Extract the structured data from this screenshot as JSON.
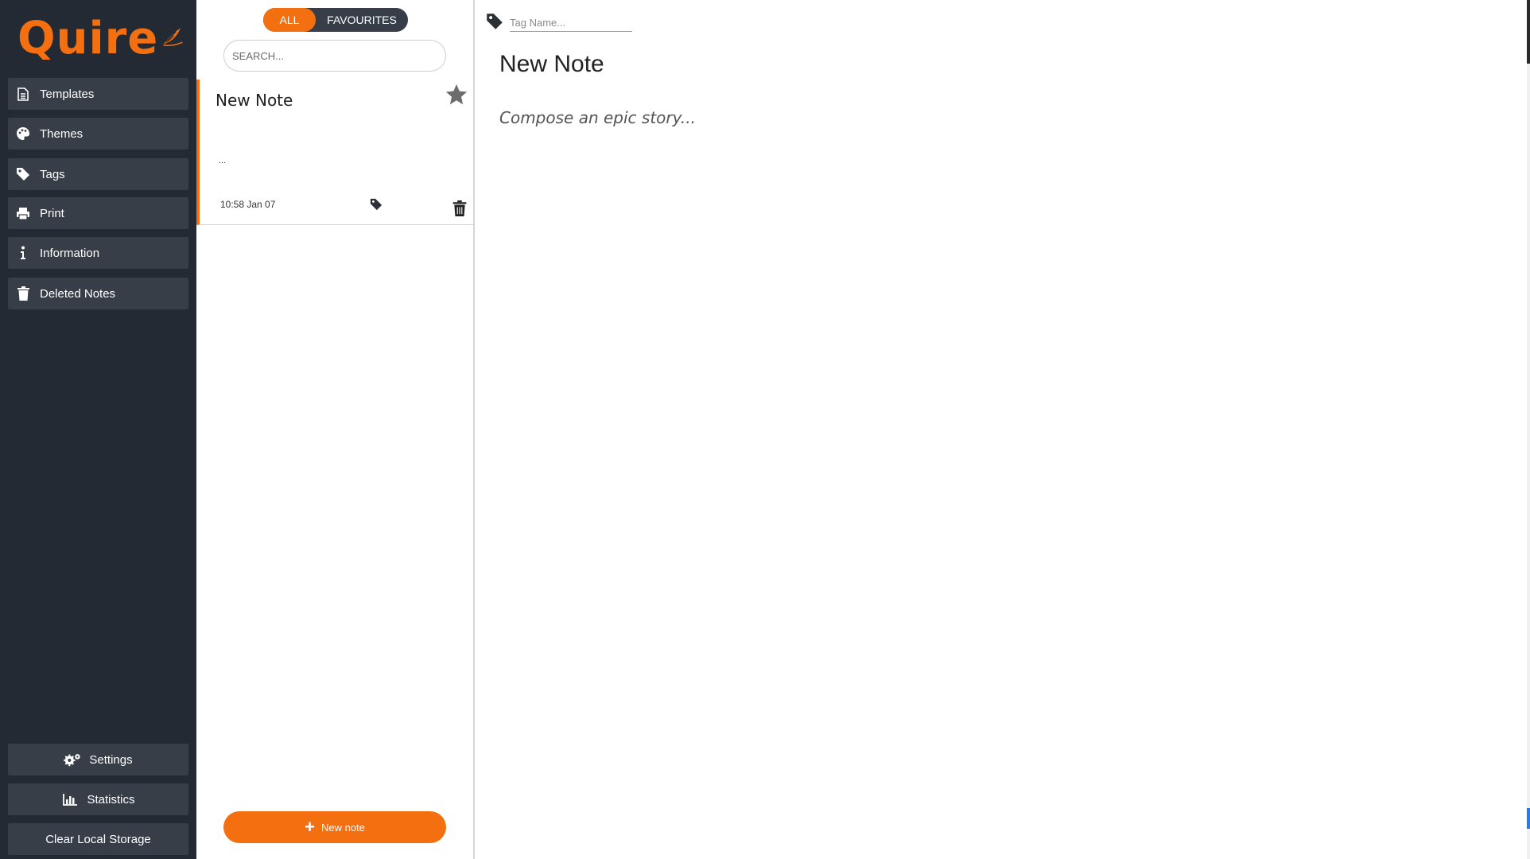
{
  "app": {
    "name": "Quire",
    "brand_color": "#f36f0f",
    "sidebar_bg": "#242a33",
    "item_bg": "#373e48"
  },
  "sidebar": {
    "items": [
      {
        "label": "Templates",
        "icon": "file-icon"
      },
      {
        "label": "Themes",
        "icon": "palette-icon"
      },
      {
        "label": "Tags",
        "icon": "tag-icon"
      },
      {
        "label": "Print",
        "icon": "printer-icon"
      },
      {
        "label": "Information",
        "icon": "info-icon"
      },
      {
        "label": "Deleted Notes",
        "icon": "trash-icon"
      }
    ],
    "bottom": [
      {
        "label": "Settings",
        "icon": "gears-icon"
      },
      {
        "label": "Statistics",
        "icon": "bar-chart-icon"
      },
      {
        "label": "Clear Local Storage"
      }
    ]
  },
  "list": {
    "filter_all": "ALL",
    "filter_favourites": "FAVOURITES",
    "search_placeholder": "SEARCH...",
    "notes": [
      {
        "title": "New Note",
        "preview": "...",
        "time": "10:58 Jan 07"
      }
    ],
    "new_note_label": "New note"
  },
  "editor": {
    "tag_placeholder": "Tag Name...",
    "title": "New Note",
    "body_placeholder": "Compose an epic story..."
  }
}
